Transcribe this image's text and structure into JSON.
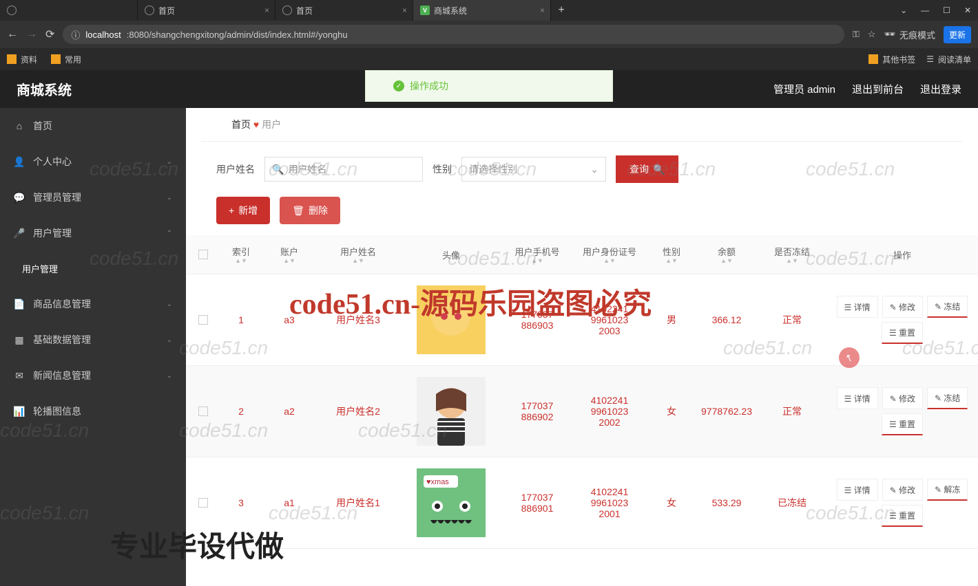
{
  "browser": {
    "tabs": [
      {
        "title": "首页"
      },
      {
        "title": "首页"
      },
      {
        "title": "商城系统"
      }
    ],
    "url_host": "localhost",
    "url_path": ":8080/shangchengxitong/admin/dist/index.html#/yonghu",
    "incognito": "无痕模式",
    "update": "更新",
    "bookmarks": {
      "b1": "资料",
      "b2": "常用",
      "other": "其他书签",
      "readlist": "阅读清单"
    }
  },
  "app": {
    "title": "商城系统",
    "header": {
      "admin": "管理员 admin",
      "front": "退出到前台",
      "logout": "退出登录"
    },
    "toast": "操作成功",
    "sidebar": {
      "home": "首页",
      "personal": "个人中心",
      "admin_mgmt": "管理员管理",
      "user_mgmt": "用户管理",
      "user_mgmt_sub": "用户管理",
      "product": "商品信息管理",
      "basic": "基础数据管理",
      "news": "新闻信息管理",
      "carousel": "轮播图信息"
    },
    "breadcrumb": {
      "home": "首页",
      "current": "用户"
    },
    "filters": {
      "name_label": "用户姓名",
      "name_placeholder": "用户姓名",
      "gender_label": "性别",
      "gender_placeholder": "请选择性别",
      "query": "查询"
    },
    "actions": {
      "add": "新增",
      "delete": "删除"
    },
    "table": {
      "headers": {
        "index": "索引",
        "account": "账户",
        "name": "用户姓名",
        "avatar": "头像",
        "phone": "用户手机号",
        "id": "用户身份证号",
        "gender": "性别",
        "balance": "余额",
        "frozen": "是否冻结",
        "ops": "操作"
      },
      "rows": [
        {
          "idx": "1",
          "account": "a3",
          "name": "用户姓名3",
          "phone": "177037886903",
          "id_card": "410224199610232003",
          "gender": "男",
          "balance": "366.12",
          "frozen": "正常"
        },
        {
          "idx": "2",
          "account": "a2",
          "name": "用户姓名2",
          "phone": "177037886902",
          "id_card": "410224199610232002",
          "gender": "女",
          "balance": "9778762.23",
          "frozen": "正常"
        },
        {
          "idx": "3",
          "account": "a1",
          "name": "用户姓名1",
          "phone": "177037886901",
          "id_card": "410224199610232001",
          "gender": "女",
          "balance": "533.29",
          "frozen": "已冻结"
        }
      ],
      "ops": {
        "detail": "详情",
        "edit": "修改",
        "freeze": "冻结",
        "unfreeze": "解冻",
        "reset": "重置"
      }
    }
  },
  "watermark_text": "code51.cn",
  "watermark_big": "code51.cn-源码乐园盗图必究",
  "watermark_bottom": "专业毕设代做"
}
